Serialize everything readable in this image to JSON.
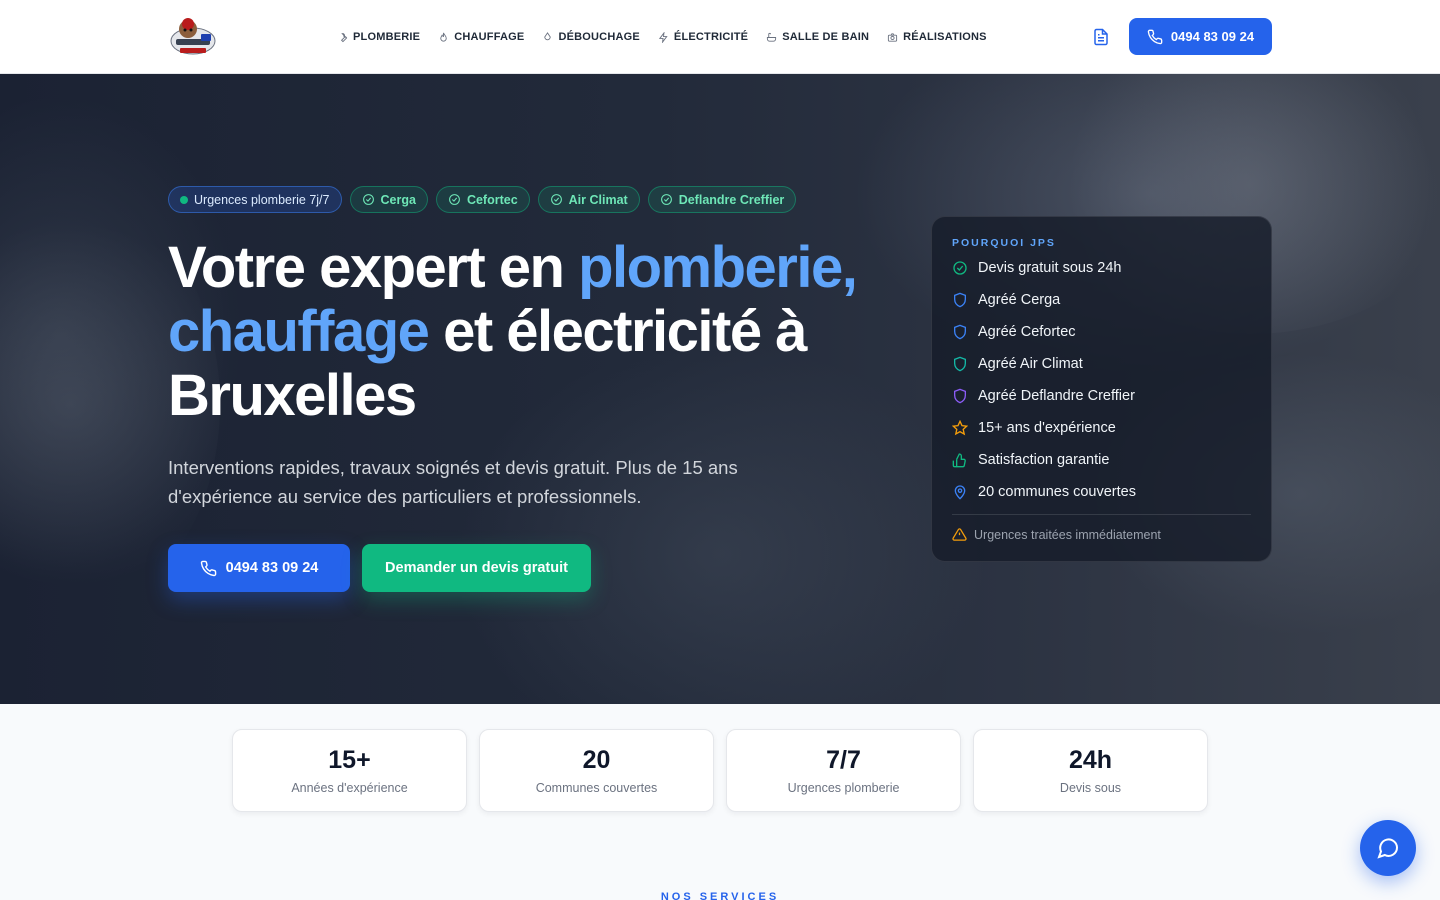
{
  "header": {
    "nav": [
      {
        "label": "PLOMBERIE",
        "icon": "wrench-icon"
      },
      {
        "label": "CHAUFFAGE",
        "icon": "flame-icon"
      },
      {
        "label": "DÉBOUCHAGE",
        "icon": "droplet-icon"
      },
      {
        "label": "ÉLECTRICITÉ",
        "icon": "bolt-icon"
      },
      {
        "label": "SALLE DE BAIN",
        "icon": "bath-icon"
      },
      {
        "label": "RÉALISATIONS",
        "icon": "camera-icon"
      }
    ],
    "phone": "0494 83 09 24"
  },
  "hero": {
    "tags": [
      "Urgences plomberie 7j/7",
      "Cerga",
      "Cefortec",
      "Air Climat",
      "Deflandre Creffier"
    ],
    "title_1": "Votre expert en ",
    "title_accent_1": "plomberie,",
    "title_accent_2": "chauffage",
    "title_2": " et électricité à Bruxelles",
    "subtitle": "Interventions rapides, travaux soignés et devis gratuit. Plus de 15 ans d'expérience au service des particuliers et professionnels.",
    "cta_phone": "0494 83 09 24",
    "cta_quote": "Demander un devis gratuit"
  },
  "why": {
    "title": "POURQUOI JPS",
    "items": [
      {
        "label": "Devis gratuit sous 24h",
        "icon": "check-circle-icon",
        "color": "#10b981"
      },
      {
        "label": "Agréé Cerga",
        "icon": "shield-icon",
        "color": "#3b82f6"
      },
      {
        "label": "Agréé Cefortec",
        "icon": "shield-icon",
        "color": "#3b82f6"
      },
      {
        "label": "Agréé Air Climat",
        "icon": "shield-icon",
        "color": "#14b8a6"
      },
      {
        "label": "Agréé Deflandre Creffier",
        "icon": "shield-icon",
        "color": "#8b5cf6"
      },
      {
        "label": "15+ ans d'expérience",
        "icon": "star-icon",
        "color": "#f59e0b"
      },
      {
        "label": "Satisfaction garantie",
        "icon": "thumbs-up-icon",
        "color": "#10b981"
      },
      {
        "label": "20 communes couvertes",
        "icon": "map-pin-icon",
        "color": "#3b82f6"
      }
    ],
    "note": "Urgences traitées immédiatement"
  },
  "stats": [
    {
      "value": "15+",
      "label": "Années d'expérience"
    },
    {
      "value": "20",
      "label": "Communes couvertes"
    },
    {
      "value": "7/7",
      "label": "Urgences plomberie"
    },
    {
      "value": "24h",
      "label": "Devis sous"
    }
  ],
  "services_label": "NOS SERVICES",
  "colors": {
    "primary": "#2563eb",
    "accent": "#60a5fa",
    "success": "#10b981"
  }
}
